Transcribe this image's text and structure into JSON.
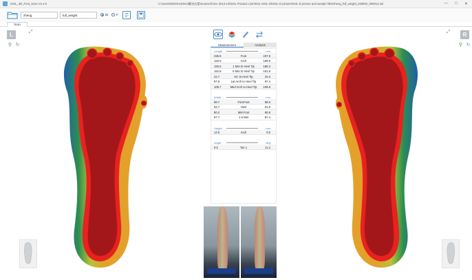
{
  "window": {
    "app_title": "ISOL_3D_Foot_Scan V1.4.0",
    "path": "C:\\Users\\MS\\OneDrive\\解决方案\\Scansoft Doc 2013-12\\ISOL Product Line\\ISOL ISOL-D\\ISOL-D picture\\ISOL-D picture and sample files\\zheng_full_weight_020803_000013.osl",
    "controls": [
      "—",
      "□",
      "✕"
    ]
  },
  "toolbar": {
    "name_value": "zheng",
    "condition_value": "full_weight",
    "radio_options": [
      {
        "label": "kit",
        "selected": true
      },
      {
        "label": "F",
        "selected": false
      }
    ]
  },
  "tabs": {
    "scan_label": "Scan"
  },
  "sides": {
    "left_label": "L",
    "right_label": "R"
  },
  "panel": {
    "subtabs": [
      "Measurement",
      "Analysis"
    ],
    "length": {
      "label": "Length",
      "unit": "mm",
      "rows": [
        {
          "left": "236.9",
          "name": "Foot",
          "right": "237.9"
        },
        {
          "left": "183.5",
          "name": "Arch",
          "right": "189.9"
        },
        {
          "left": "183.0",
          "name": "1 Met to Heel Tip",
          "right": "186.3"
        },
        {
          "left": "152.6",
          "name": "5 Met to Heel Tip",
          "right": "161.8"
        },
        {
          "left": "22.7",
          "name": "HC to Heel Tip",
          "right": "23.3"
        },
        {
          "left": "97.8",
          "name": "Lat Arch to Heel Tip",
          "right": "97.4"
        },
        {
          "left": "108.7",
          "name": "Med Arch to Heel Tip",
          "right": "109.8"
        }
      ]
    },
    "width": {
      "label": "Width",
      "unit": "mm",
      "rows": [
        {
          "left": "88.7",
          "name": "ForeFoot",
          "right": "88.5"
        },
        {
          "left": "62.7",
          "name": "Heel",
          "right": "61.8"
        },
        {
          "left": "80.2",
          "name": "Mid-Foot",
          "right": "80.8"
        },
        {
          "left": "87.7",
          "name": "1-5 Met",
          "right": "87.4"
        }
      ]
    },
    "height": {
      "label": "Height",
      "unit": "mm",
      "rows": [
        {
          "left": "14.0",
          "name": "Arch",
          "right": "0.6"
        }
      ]
    },
    "angle": {
      "label": "Angle",
      "unit": "deg",
      "rows": [
        {
          "left": "9.5",
          "name": "Toe 1",
          "right": "11.2"
        }
      ]
    }
  },
  "colors": {
    "accent": "#2c6fbf",
    "pressure_high": "#a3171b",
    "pressure_edge": "#e8221e",
    "pressure_mid": "#e3a12b",
    "pressure_low": "#2e8f4f"
  }
}
